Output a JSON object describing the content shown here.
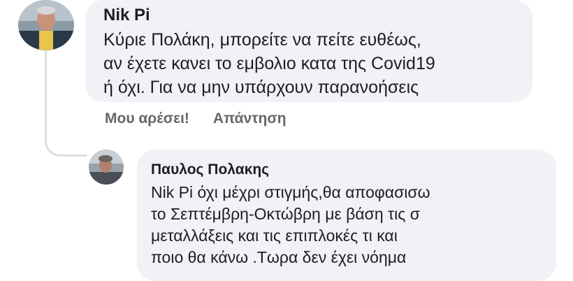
{
  "comment": {
    "author": "Nik Pi",
    "lines": [
      "Κύριε Πολάκη, μπορείτε να πείτε ευθέως,",
      "αν έχετε κανει το εμβολιο κατα της Covid19",
      "ή όχι. Για να μην υπάρχουν παρανοήσεις"
    ],
    "actions": {
      "like_label": "Μου αρέσει!",
      "reply_label": "Απάντηση"
    }
  },
  "reply": {
    "author": "Παυλος Πολακης",
    "lines": [
      "Nik Pi όχι μέχρι στιγμής,θα αποφασισω",
      "το Σεπτέμβρη-Οκτώβρη με βάση τις σ",
      "μεταλλάξεις και τις επιπλοκές τι και",
      "ποιο θα κάνω .Τωρα δεν έχει νόημα"
    ]
  },
  "icons": {
    "comment_avatar": "user-photo",
    "reply_avatar": "user-photo"
  },
  "colors": {
    "bubble": "#f0f2f5",
    "text": "#1c1e21",
    "meta": "#65676b",
    "thread_line": "#dcdfe4"
  }
}
